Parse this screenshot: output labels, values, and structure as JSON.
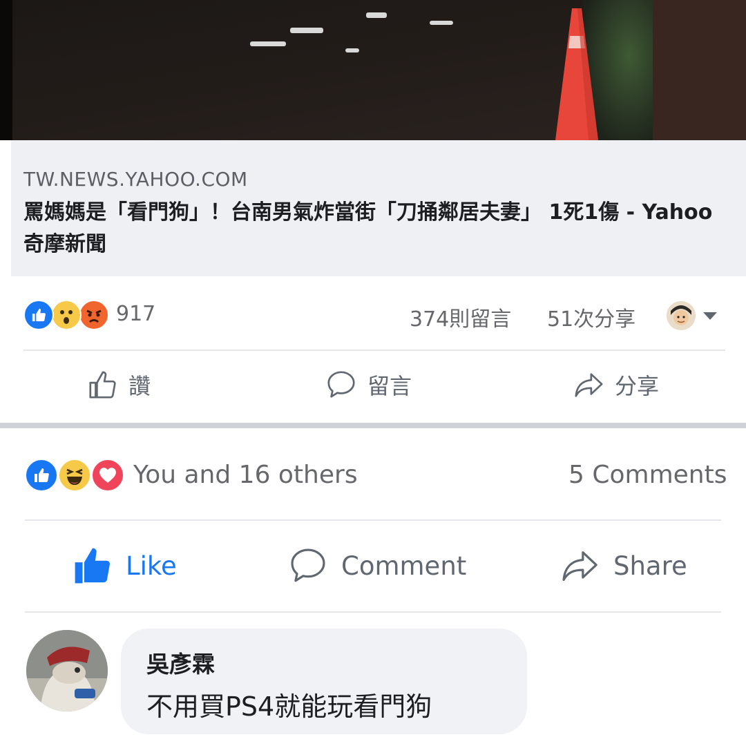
{
  "link_preview": {
    "domain": "TW.NEWS.YAHOO.COM",
    "title": "罵媽媽是「看門狗」！台南男氣炸當街「刀捅鄰居夫妻」 1死1傷 - Yahoo奇摩新聞"
  },
  "shared_post_stats": {
    "reaction_icons": [
      "like-icon",
      "wow-icon",
      "angry-icon"
    ],
    "reaction_count": "917",
    "comments": "374則留言",
    "shares": "51次分享"
  },
  "shared_post_actions": [
    {
      "label": "讚",
      "icon": "thumbs-up-outline-icon"
    },
    {
      "label": "留言",
      "icon": "comment-bubble-icon"
    },
    {
      "label": "分享",
      "icon": "share-arrow-icon"
    }
  ],
  "post_stats": {
    "reaction_icons": [
      "like-icon",
      "haha-icon",
      "love-icon"
    ],
    "reaction_text": "You and 16 others",
    "comments": "5 Comments"
  },
  "post_actions": [
    {
      "label": "Like",
      "icon": "thumbs-up-filled-icon",
      "active": true
    },
    {
      "label": "Comment",
      "icon": "comment-bubble-icon"
    },
    {
      "label": "Share",
      "icon": "share-arrow-icon"
    }
  ],
  "comment": {
    "author": "吳彥霖",
    "text": "不用買PS4就能玩看門狗"
  },
  "colors": {
    "facebook_blue": "#1877f2",
    "text_gray": "#65676b",
    "preview_bg": "#eef0f4",
    "bubble_bg": "#f0f2f5"
  }
}
